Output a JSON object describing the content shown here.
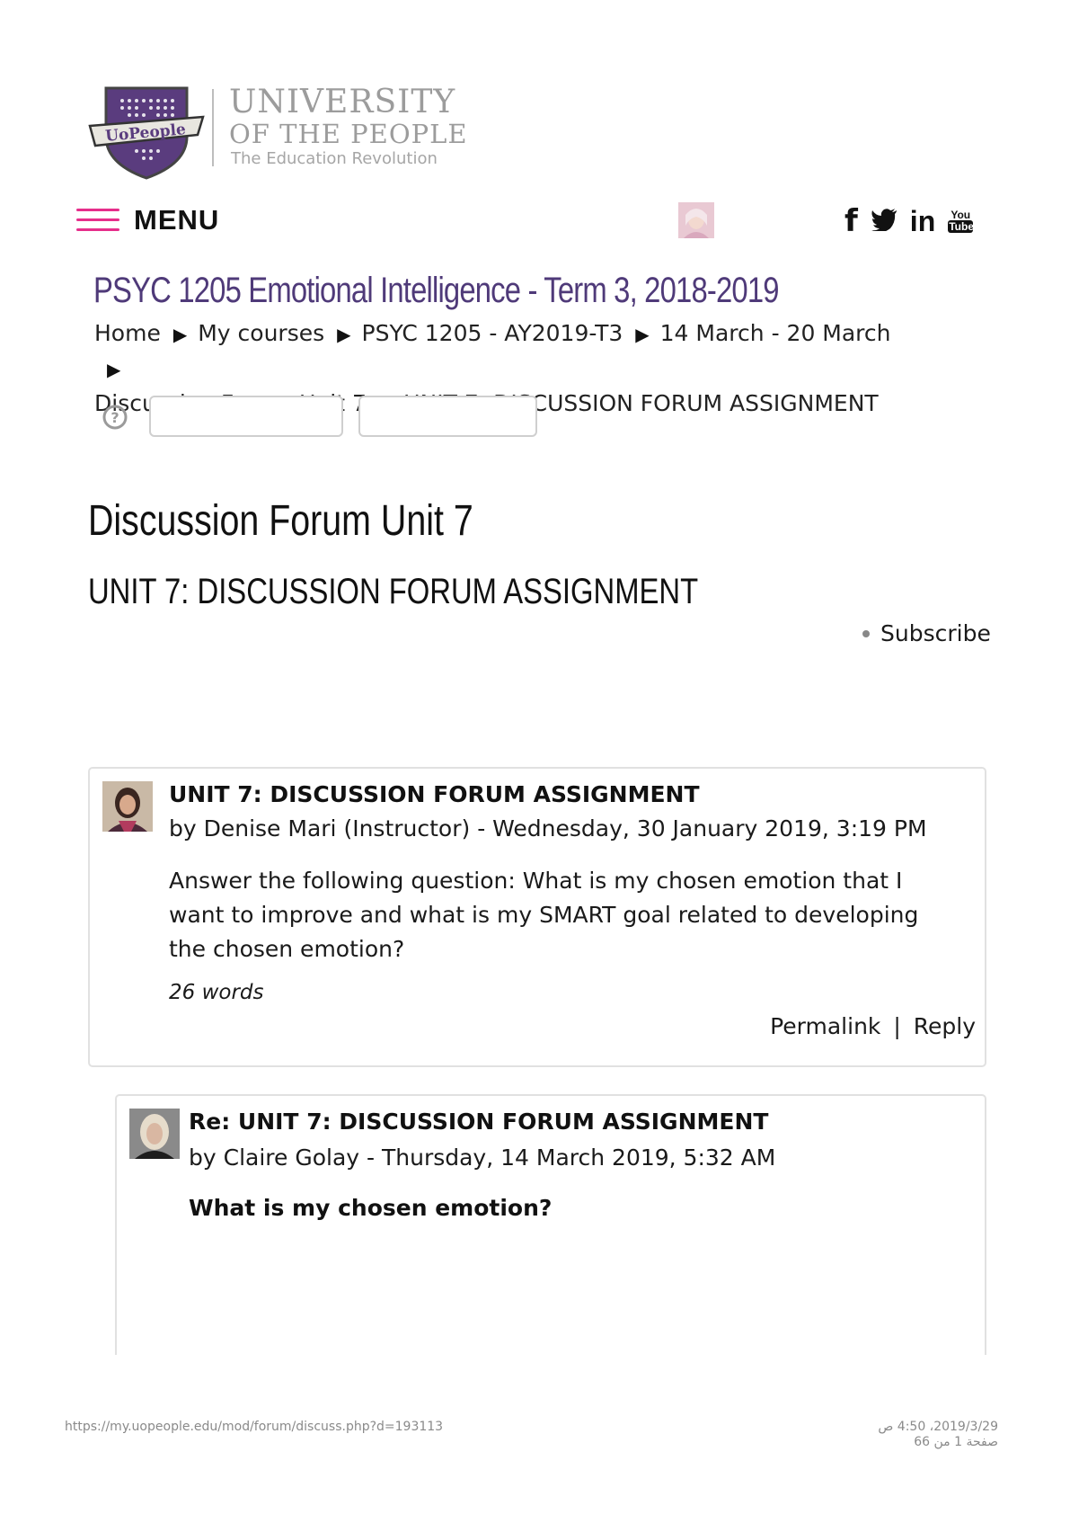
{
  "logo": {
    "badge_text": "UoPeople",
    "line1": "UNIVERSITY",
    "line2": "OF THE PEOPLE",
    "tagline": "The Education Revolution"
  },
  "header": {
    "menu_label": "MENU",
    "socials": [
      {
        "icon": "facebook-icon",
        "glyph": "f"
      },
      {
        "icon": "twitter-icon",
        "glyph": "t"
      },
      {
        "icon": "linkedin-icon",
        "glyph": "in"
      },
      {
        "icon": "youtube-icon",
        "glyph": "You Tube"
      }
    ]
  },
  "course": {
    "title": "PSYC 1205 Emotional Intelligence - Term 3, 2018-2019"
  },
  "breadcrumb": [
    "Home",
    "My courses",
    "PSYC 1205 - AY2019-T3",
    "14 March - 20 March",
    "Discussion Forum Unit 7",
    "UNIT 7: DISCUSSION FORUM ASSIGNMENT"
  ],
  "forum": {
    "title": "Discussion Forum Unit 7",
    "discussion_title": "UNIT 7: DISCUSSION FORUM ASSIGNMENT",
    "subscribe_label": "Subscribe"
  },
  "posts": [
    {
      "subject": "UNIT 7: DISCUSSION FORUM ASSIGNMENT",
      "byline": "by Denise Mari (Instructor) - Wednesday, 30 January 2019, 3:19 PM",
      "body": "Answer the following question: What is my chosen emotion that I want to improve and what is my SMART goal related to developing the chosen emotion?",
      "word_count": "26 words",
      "permalink_label": "Permalink",
      "separator": "|",
      "reply_label": "Reply"
    },
    {
      "subject": "Re: UNIT 7: DISCUSSION FORUM ASSIGNMENT",
      "byline": "by Claire Golay - Thursday, 14 March 2019, 5:32 AM",
      "body_heading": "What is my chosen emotion?"
    }
  ],
  "footer": {
    "url": "https://my.uopeople.edu/mod/forum/discuss.php?d=193113",
    "datetime": "2019/3/29، 4:50 ص",
    "page": "صفحة 1 من 66"
  },
  "colors": {
    "brand_purple": "#4f3a79",
    "menu_pink": "#e62e8b",
    "logo_gray": "#9c9c9c"
  }
}
